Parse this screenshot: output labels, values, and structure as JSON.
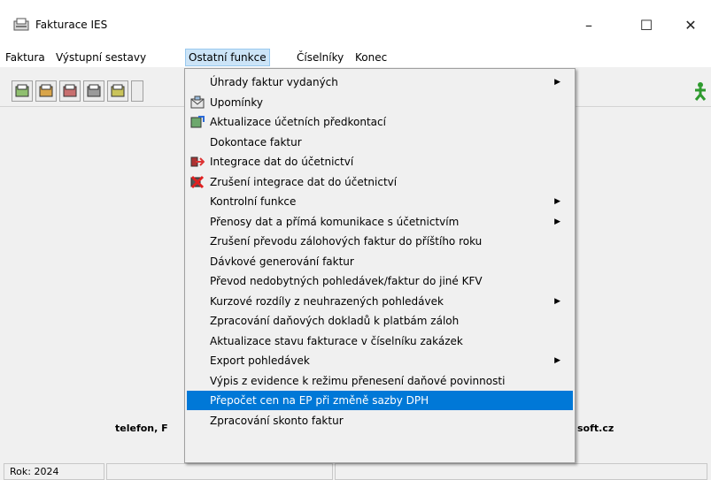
{
  "window": {
    "title": "Fakturace IES",
    "minimize": "–",
    "maximize": "☐",
    "close": "✕"
  },
  "menubar": [
    "Faktura",
    "Výstupní sestavy",
    "Ostatní funkce",
    "Číselníky",
    "Konec"
  ],
  "menu": {
    "items": [
      {
        "label": "Úhrady faktur vydaných",
        "submenu": true,
        "icon": ""
      },
      {
        "label": "Upomínky",
        "submenu": false,
        "icon": "envelope-icon"
      },
      {
        "label": "Aktualizace účetních předkontací",
        "submenu": false,
        "icon": "refresh-icon"
      },
      {
        "label": "Dokontace faktur",
        "submenu": false,
        "icon": ""
      },
      {
        "label": "Integrace dat do účetnictví",
        "submenu": false,
        "icon": "integrate-icon"
      },
      {
        "label": "Zrušení integrace dat do účetnictví",
        "submenu": false,
        "icon": "cancel-integrate-icon"
      },
      {
        "label": "Kontrolní funkce",
        "submenu": true,
        "icon": ""
      },
      {
        "label": "Přenosy dat a přímá komunikace s účetnictvím",
        "submenu": true,
        "icon": ""
      },
      {
        "label": "Zrušení převodu zálohových faktur do příštího roku",
        "submenu": false,
        "icon": ""
      },
      {
        "label": "Dávkové generování faktur",
        "submenu": false,
        "icon": ""
      },
      {
        "label": "Převod nedobytných pohledávek/faktur do jiné KFV",
        "submenu": false,
        "icon": ""
      },
      {
        "label": "Kurzové rozdíly z neuhrazených pohledávek",
        "submenu": true,
        "icon": ""
      },
      {
        "label": "Zpracování daňových dokladů k platbám záloh",
        "submenu": false,
        "icon": ""
      },
      {
        "label": "Aktualizace stavu fakturace v číselníku zakázek",
        "submenu": false,
        "icon": ""
      },
      {
        "label": "Export pohledávek",
        "submenu": true,
        "icon": ""
      },
      {
        "label": "Výpis z evidence k režimu přenesení daňové povinnosti",
        "submenu": false,
        "icon": ""
      },
      {
        "label": "Přepočet cen na EP při změně sazby DPH",
        "submenu": false,
        "icon": "",
        "highlighted": true
      },
      {
        "label": "Zpracování skonto faktur",
        "submenu": false,
        "icon": ""
      }
    ],
    "arrow": "▶"
  },
  "footer": {
    "left": "telefon, F",
    "right": "soft.cz"
  },
  "status": {
    "year": "Rok: 2024"
  },
  "colors": {
    "highlight": "#0078d7",
    "menu_active": "#cce4f7"
  }
}
